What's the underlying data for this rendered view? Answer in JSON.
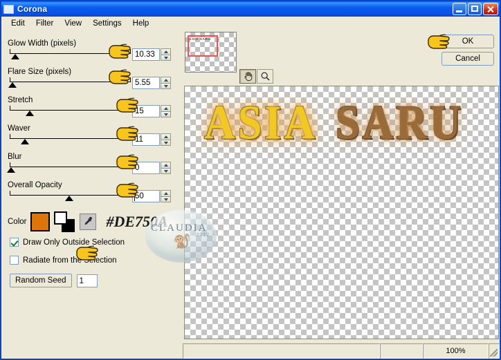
{
  "window": {
    "title": "Corona",
    "icon": "application-icon",
    "controls": {
      "minimize": "minimize-button",
      "maximize": "maximize-button",
      "close": "close-button"
    }
  },
  "menubar": {
    "items": [
      {
        "label": "Edit"
      },
      {
        "label": "Filter"
      },
      {
        "label": "View"
      },
      {
        "label": "Settings"
      },
      {
        "label": "Help"
      }
    ]
  },
  "controls": {
    "sliders": [
      {
        "label": "Glow Width (pixels)",
        "value": "10.33",
        "thumb_pct": 6,
        "focused": false
      },
      {
        "label": "Flare Size (pixels)",
        "value": "5.55",
        "thumb_pct": 4,
        "focused": false
      },
      {
        "label": "Stretch",
        "value": "15",
        "thumb_pct": 18,
        "focused": false
      },
      {
        "label": "Waver",
        "value": "11",
        "thumb_pct": 14,
        "focused": false
      },
      {
        "label": "Blur",
        "value": "0",
        "thumb_pct": 3,
        "focused": false
      },
      {
        "label": "Overall Opacity",
        "value": "50",
        "thumb_pct": 50,
        "focused": true
      }
    ],
    "color": {
      "label": "Color",
      "primary_hex": "#DE750A",
      "secondary_hex": "#FFFFFF",
      "tertiary_hex": "#000000",
      "annotation": "#DE750A",
      "eyedropper": "eyedropper-icon"
    },
    "checkboxes": [
      {
        "label": "Draw Only Outside Selection",
        "checked": true
      },
      {
        "label": "Radiate from the Selection",
        "checked": false
      }
    ],
    "random_seed": {
      "button_label": "Random Seed",
      "value": "1"
    }
  },
  "preview": {
    "navigator": {
      "thumb_label": "ASIA SARU"
    },
    "tools": [
      {
        "name": "pan-tool",
        "glyph": "hand",
        "active": true
      },
      {
        "name": "zoom-tool",
        "glyph": "magnifier",
        "active": false
      }
    ],
    "canvas": {
      "word_one": "ASIA",
      "word_two": "SARU"
    }
  },
  "dialog_buttons": {
    "ok": "OK",
    "cancel": "Cancel"
  },
  "statusbar": {
    "left": "",
    "middle": "",
    "zoom": "100%"
  },
  "watermark": {
    "text": "CLAUDIA",
    "year": "2012"
  }
}
